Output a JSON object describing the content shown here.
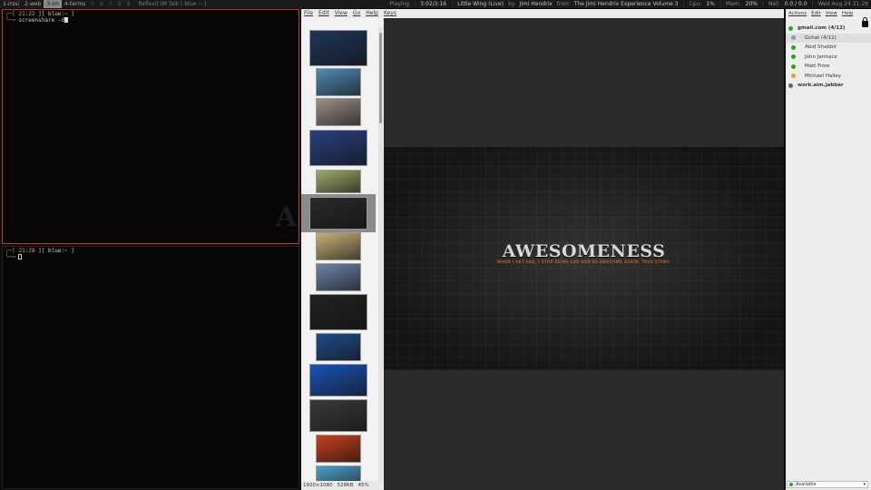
{
  "topbar": {
    "tags": [
      {
        "label": "1-irssi",
        "state": "normal"
      },
      {
        "label": "2-web",
        "state": "normal"
      },
      {
        "label": "3-im",
        "state": "active"
      },
      {
        "label": "4-terms",
        "state": "normal"
      },
      {
        "label": "5",
        "state": "dim"
      },
      {
        "label": "6",
        "state": "dim"
      },
      {
        "label": "7",
        "state": "dim"
      },
      {
        "label": "8",
        "state": "dim"
      },
      {
        "label": "9",
        "state": "dim"
      }
    ],
    "window_title": "Reflexit IM Talk  [ blue ~ ]",
    "status": {
      "mpd_state": "Playing",
      "mpd_time": "3:02/3:16",
      "song": "Little Wing (Live)",
      "by_word": "by",
      "artist": "Jimi Hendrix",
      "from_word": "from",
      "album": "The Jimi Hendrix Experience Volume 3",
      "cpu_label": "Cpu:",
      "cpu_value": "1%",
      "mem_label": "Mem:",
      "mem_value": "20%",
      "net_label": "Net:",
      "net_value": "0.0 / 0.0",
      "date": "Wed Aug 24 21:28"
    }
  },
  "terminals": [
    {
      "line1_time": "21:22",
      "line1_rest": " ][ blue:~ ]",
      "line2_prompt": "screenshare -d",
      "focused": true
    },
    {
      "line1_time": "21:28",
      "line1_rest": " ][ blue:~ ]",
      "line2_prompt": "",
      "focused": false
    }
  ],
  "viewer": {
    "menu": [
      "File",
      "Edit",
      "View",
      "Go",
      "Help",
      "Keys"
    ],
    "preview_title": "AWESOMENESS",
    "preview_subtitle": "WHEN I GET SAD, I STOP BEING SAD AND BE AWESOME AGAIN. TRUE STORY.",
    "status": {
      "resolution": "1920×1080",
      "size": "528KB",
      "zoom": "45%"
    },
    "selected_index": 5,
    "thumb_colors": [
      "#203658",
      "#4f8bb5",
      "#9a8f86",
      "#294080",
      "#9dab6a",
      "#2a2a2a",
      "#c9b076",
      "#6d84a8",
      "#222222",
      "#1f4d8a",
      "#1b52b8",
      "#3a3a3a",
      "#c8401e",
      "#4ba0c8"
    ]
  },
  "chat": {
    "menu": [
      "Actions",
      "Edit",
      "View",
      "Help"
    ],
    "contacts": [
      {
        "name": "gmail.com (4/12)",
        "status": "#22aa22",
        "group": true,
        "indent": false
      },
      {
        "name": "Gchat (4/12)",
        "status": "#8a9ad0",
        "group": false,
        "indent": true,
        "highlight": true
      },
      {
        "name": "Abid Shabbir",
        "status": "#22aa22",
        "group": false,
        "indent": true
      },
      {
        "name": "John Jarmacz",
        "status": "#22aa22",
        "group": false,
        "indent": true
      },
      {
        "name": "Matt Fiore",
        "status": "#22aa22",
        "group": false,
        "indent": true
      },
      {
        "name": "Michael Halley",
        "status": "#e0a020",
        "group": false,
        "indent": true
      },
      {
        "name": "work.aim.jabber",
        "status": "#666666",
        "group": true,
        "indent": false
      }
    ],
    "presence": "Available"
  }
}
